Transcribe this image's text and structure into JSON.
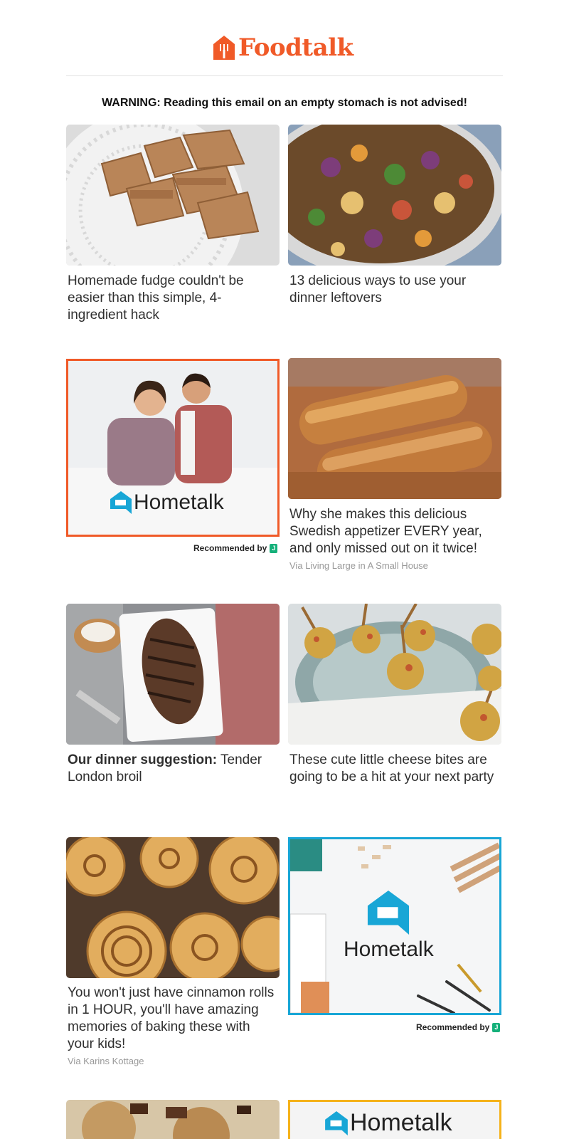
{
  "brand": {
    "name": "Foodtalk",
    "color": "#f05a28"
  },
  "warning": "WARNING: Reading this email on an empty stomach is not advised!",
  "cards": [
    {
      "title": "Homemade fudge couldn't be easier than this simple, 4-ingredient hack",
      "image": "fudge-squares-photo"
    },
    {
      "title": "13 delicious ways to use your dinner leftovers",
      "image": "stir-fry-bowl-photo"
    },
    {
      "title": "Why she makes this delicious Swedish appetizer EVERY year, and only missed out on it twice!",
      "via": "Via Living Large in A Small House",
      "image": "sausage-photo"
    },
    {
      "title_bold": "Our dinner suggestion:",
      "title_rest": " Tender London broil",
      "image": "london-broil-steak-photo"
    },
    {
      "title": "These cute little cheese bites are going to be a hit at your next party",
      "image": "cheese-bites-photo"
    },
    {
      "title": "You won't just have cinnamon rolls in 1 HOUR, you'll have amazing memories of baking these with your kids!",
      "via": "Via Karins Kottage",
      "image": "cinnamon-rolls-photo"
    }
  ],
  "ads": [
    {
      "brand": "Hometalk",
      "recommended": "Recommended by",
      "border_color": "#f05a28"
    },
    {
      "brand": "Hometalk",
      "recommended": "Recommended by",
      "border_color": "#18a6d6"
    },
    {
      "brand": "Hometalk",
      "border_color": "#f5b21a"
    }
  ],
  "bottom_row": {
    "image": "cookies-photo"
  }
}
